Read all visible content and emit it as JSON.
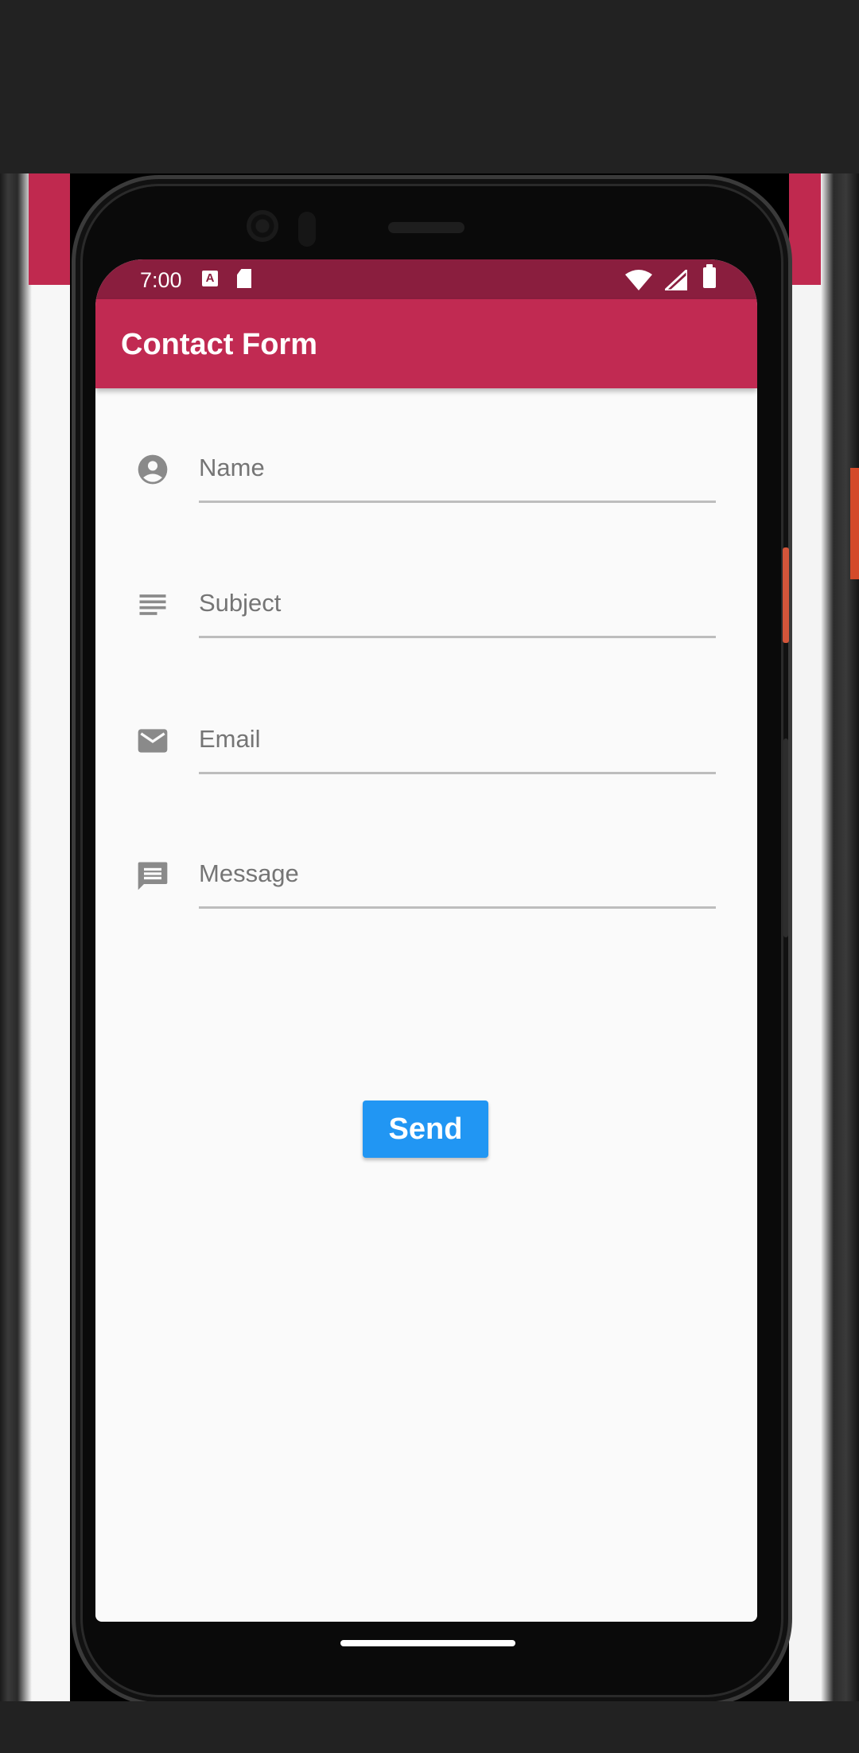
{
  "status_bar": {
    "time": "7:00",
    "notification_icons": [
      "a-badge-icon",
      "sd-card-icon"
    ],
    "system_icons": [
      "wifi-icon",
      "signal-icon",
      "battery-icon"
    ],
    "color": "#8a1e3e"
  },
  "app_bar": {
    "title": "Contact Form",
    "color": "#c12a52"
  },
  "form": {
    "fields": [
      {
        "icon": "account-circle-icon",
        "placeholder": "Name",
        "value": ""
      },
      {
        "icon": "subject-lines-icon",
        "placeholder": "Subject",
        "value": ""
      },
      {
        "icon": "mail-icon",
        "placeholder": "Email",
        "value": ""
      },
      {
        "icon": "message-icon",
        "placeholder": "Message",
        "value": ""
      }
    ],
    "send_label": "Send",
    "send_color": "#2196f3"
  }
}
